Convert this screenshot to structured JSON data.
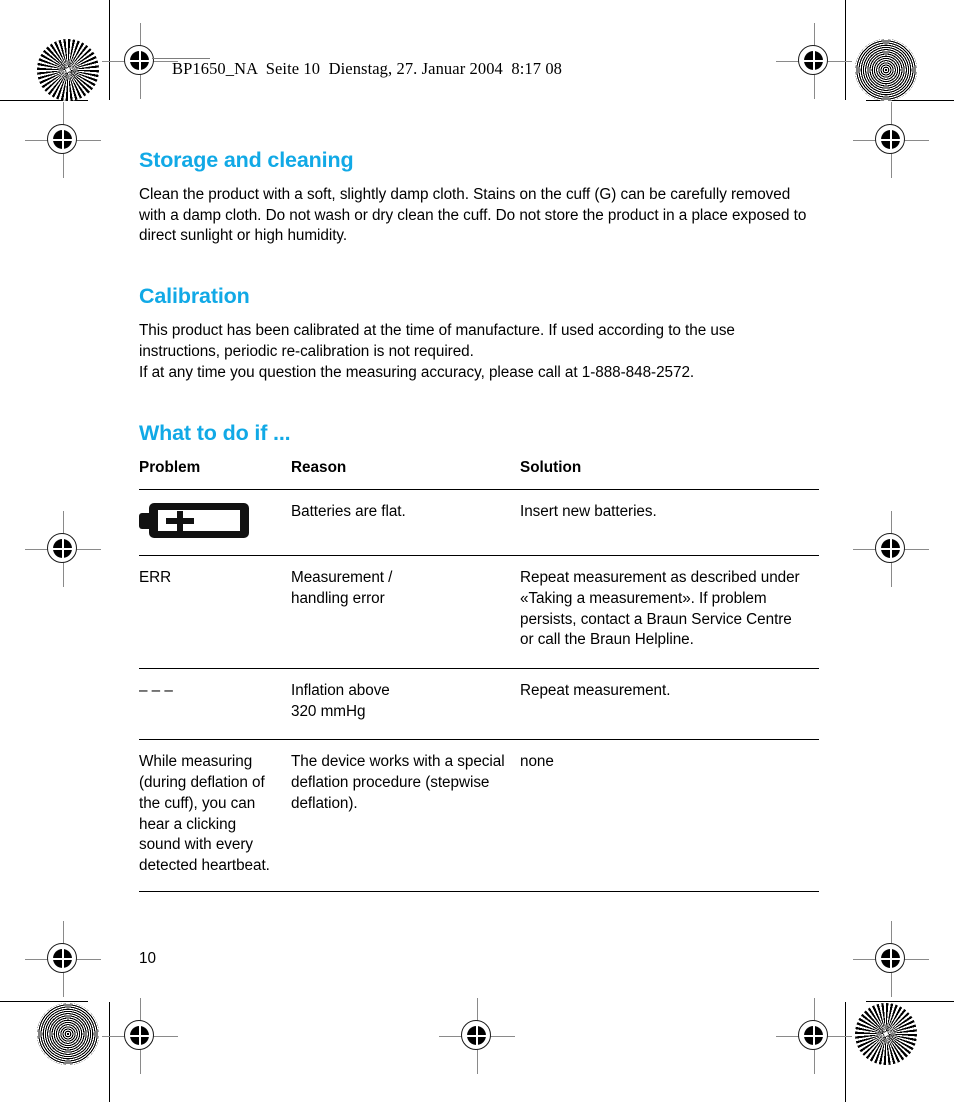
{
  "running_header": "BP1650_NA  Seite 10  Dienstag, 27. Januar 2004  8:17 08",
  "page_number": "10",
  "accent_color": "#11a9e6",
  "sections": [
    {
      "heading": "Storage and cleaning",
      "body": "Clean the product with a soft, slightly damp cloth. Stains on the cuff (G) can be carefully removed with a damp cloth. Do not wash or dry clean the cuff. Do not store the product in a place exposed to direct sunlight or high humidity."
    },
    {
      "heading": "Calibration",
      "body": "This product has been calibrated at the time of manufacture. If used according to the use instructions, periodic re-calibration is not required.\nIf at any time you question the measuring accuracy, please call at 1-888-848-2572."
    },
    {
      "heading": "What to do if ..."
    }
  ],
  "table": {
    "columns": [
      "Problem",
      "Reason",
      "Solution"
    ],
    "rows": [
      {
        "problem_icon": "battery-low-icon",
        "problem": "",
        "reason": "Batteries are flat.",
        "solution": "Insert new batteries."
      },
      {
        "problem": "ERR",
        "reason": "Measurement /\nhandling error",
        "solution": "Repeat measurement as described under «Taking a measurement». If problem persists, contact a Braun Service Centre or call the Braun Helpline."
      },
      {
        "problem": "– – –",
        "reason": "Inflation above\n320 mmHg",
        "solution": "Repeat measurement."
      },
      {
        "problem": "While measuring (during deflation of the cuff), you can hear a clicking sound with every detected heartbeat.",
        "reason": "The device works with a special deflation procedure (stepwise deflation).",
        "solution": "none"
      }
    ]
  },
  "print_marks": {
    "registration_icon": "registration-target-icon",
    "star_icon": "star-resolution-target-icon",
    "moire_icon": "moire-resolution-target-icon"
  }
}
